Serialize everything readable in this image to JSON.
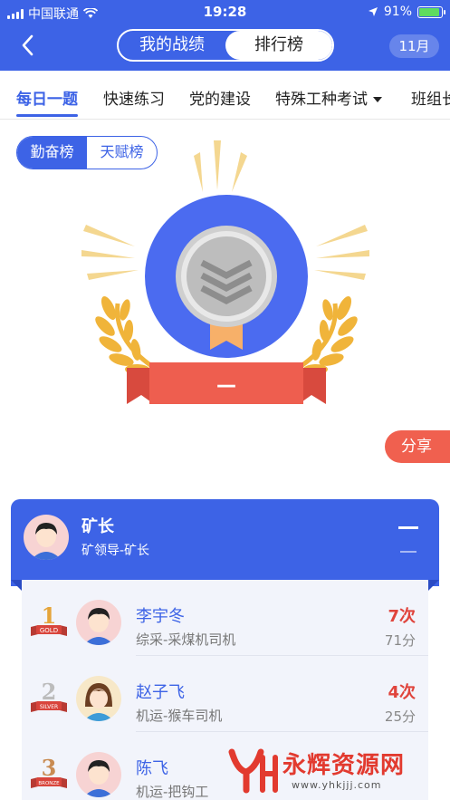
{
  "status_bar": {
    "carrier": "中国联通",
    "time": "19:28",
    "battery": "91%",
    "battery_fraction": 0.91
  },
  "nav": {
    "segments": [
      "我的战绩",
      "排行榜"
    ],
    "active_segment": 1,
    "month": "11月"
  },
  "tabs": [
    {
      "label": "每日一题"
    },
    {
      "label": "快速练习"
    },
    {
      "label": "党的建设"
    },
    {
      "label": "特殊工种考试"
    },
    {
      "label": "班组长"
    }
  ],
  "toggle": {
    "options": [
      "勤奋榜",
      "天赋榜"
    ],
    "active": 0
  },
  "medal": {
    "rank_text": "—"
  },
  "share_label": "分享",
  "me": {
    "name": "矿长",
    "role": "矿领导-矿长",
    "rank": "—",
    "score": "—"
  },
  "rows": [
    {
      "name": "李宇冬",
      "dept": "综采-采煤机司机",
      "count": "7次",
      "score": "71分",
      "badge_label": "GOLD",
      "badge_num": "1"
    },
    {
      "name": "赵子飞",
      "dept": "机运-猴车司机",
      "count": "4次",
      "score": "25分",
      "badge_label": "SILVER",
      "badge_num": "2"
    },
    {
      "name": "陈飞",
      "dept": "机运-把钩工",
      "count": "",
      "score": "",
      "badge_label": "BRONZE",
      "badge_num": "3"
    }
  ],
  "watermark": {
    "title": "永辉资源网",
    "url": "www.yhkjjj.com"
  },
  "colors": {
    "primary": "#3d63e6",
    "accent_red": "#e0443c",
    "share_red": "#f0604f",
    "gold": "#f0b43a"
  }
}
